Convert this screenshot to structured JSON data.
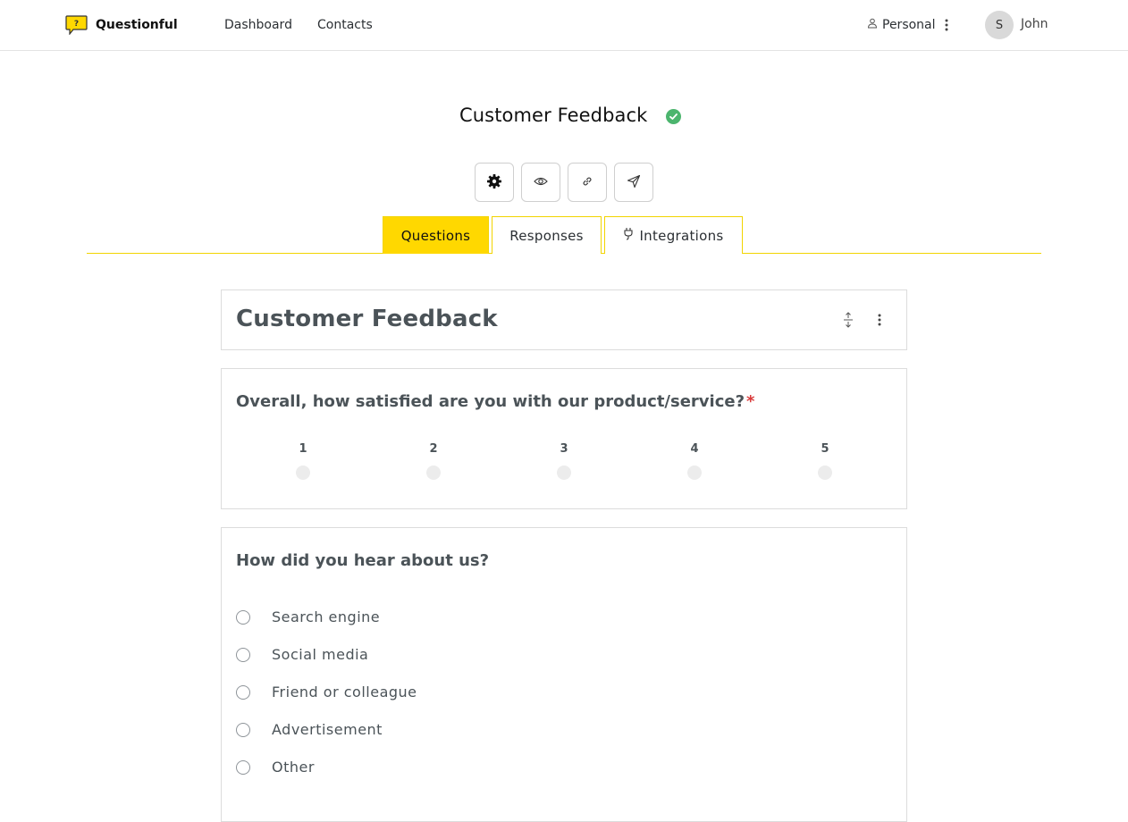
{
  "app": {
    "brand_name": "Questionful",
    "accent_color": "#ffd800",
    "success_color": "#4cb56e"
  },
  "nav": {
    "links": [
      {
        "label": "Dashboard"
      },
      {
        "label": "Contacts"
      }
    ],
    "workspace_label": "Personal",
    "avatar_initial": "S",
    "user_name": "John"
  },
  "survey": {
    "title": "Customer Feedback",
    "status": "published",
    "toolbar": [
      {
        "icon": "gear-icon",
        "action": "settings"
      },
      {
        "icon": "eye-icon",
        "action": "preview"
      },
      {
        "icon": "link-icon",
        "action": "copy link"
      },
      {
        "icon": "send-icon",
        "action": "send"
      }
    ]
  },
  "tabs": [
    {
      "label": "Questions",
      "active": true
    },
    {
      "label": "Responses",
      "active": false
    },
    {
      "label": "Integrations",
      "active": false,
      "icon": "plug-icon"
    }
  ],
  "form": {
    "title": "Customer Feedback",
    "questions": [
      {
        "text": "Overall, how satisfied are you with our product/service?",
        "required_mark": "*",
        "type": "scale",
        "scale": [
          "1",
          "2",
          "3",
          "4",
          "5"
        ]
      },
      {
        "text": "How did you hear about us?",
        "type": "single-choice",
        "options": [
          "Search engine",
          "Social media",
          "Friend or colleague",
          "Advertisement",
          "Other"
        ]
      }
    ]
  }
}
